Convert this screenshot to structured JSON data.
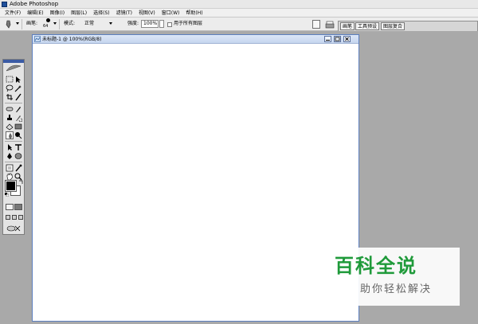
{
  "window": {
    "title": "Adobe Photoshop"
  },
  "menu": {
    "items": [
      "文件(F)",
      "编辑(E)",
      "图像(I)",
      "图层(L)",
      "选择(S)",
      "滤镜(T)",
      "视图(V)",
      "窗口(W)",
      "帮助(H)"
    ]
  },
  "options": {
    "brush_label": "画笔:",
    "brush_size": "64",
    "mode_label": "模式:",
    "mode_value": "正常",
    "opacity_label": "强度:",
    "opacity_value": "100%",
    "sample_all_layers": "用于所有图层",
    "sample_all_layers_checked": false
  },
  "palette_well": {
    "tabs": [
      "画笔",
      "工具预设",
      "图层复合"
    ]
  },
  "document": {
    "title": "未标题-1 @ 100%(RGB/8)",
    "canvas_color": "#ffffff"
  },
  "watermark": {
    "title": "百科全说",
    "subtitle": "助你轻松解决"
  },
  "colors": {
    "foreground": "#000000",
    "background": "#ffffff",
    "workspace": "#a9a9a9"
  }
}
